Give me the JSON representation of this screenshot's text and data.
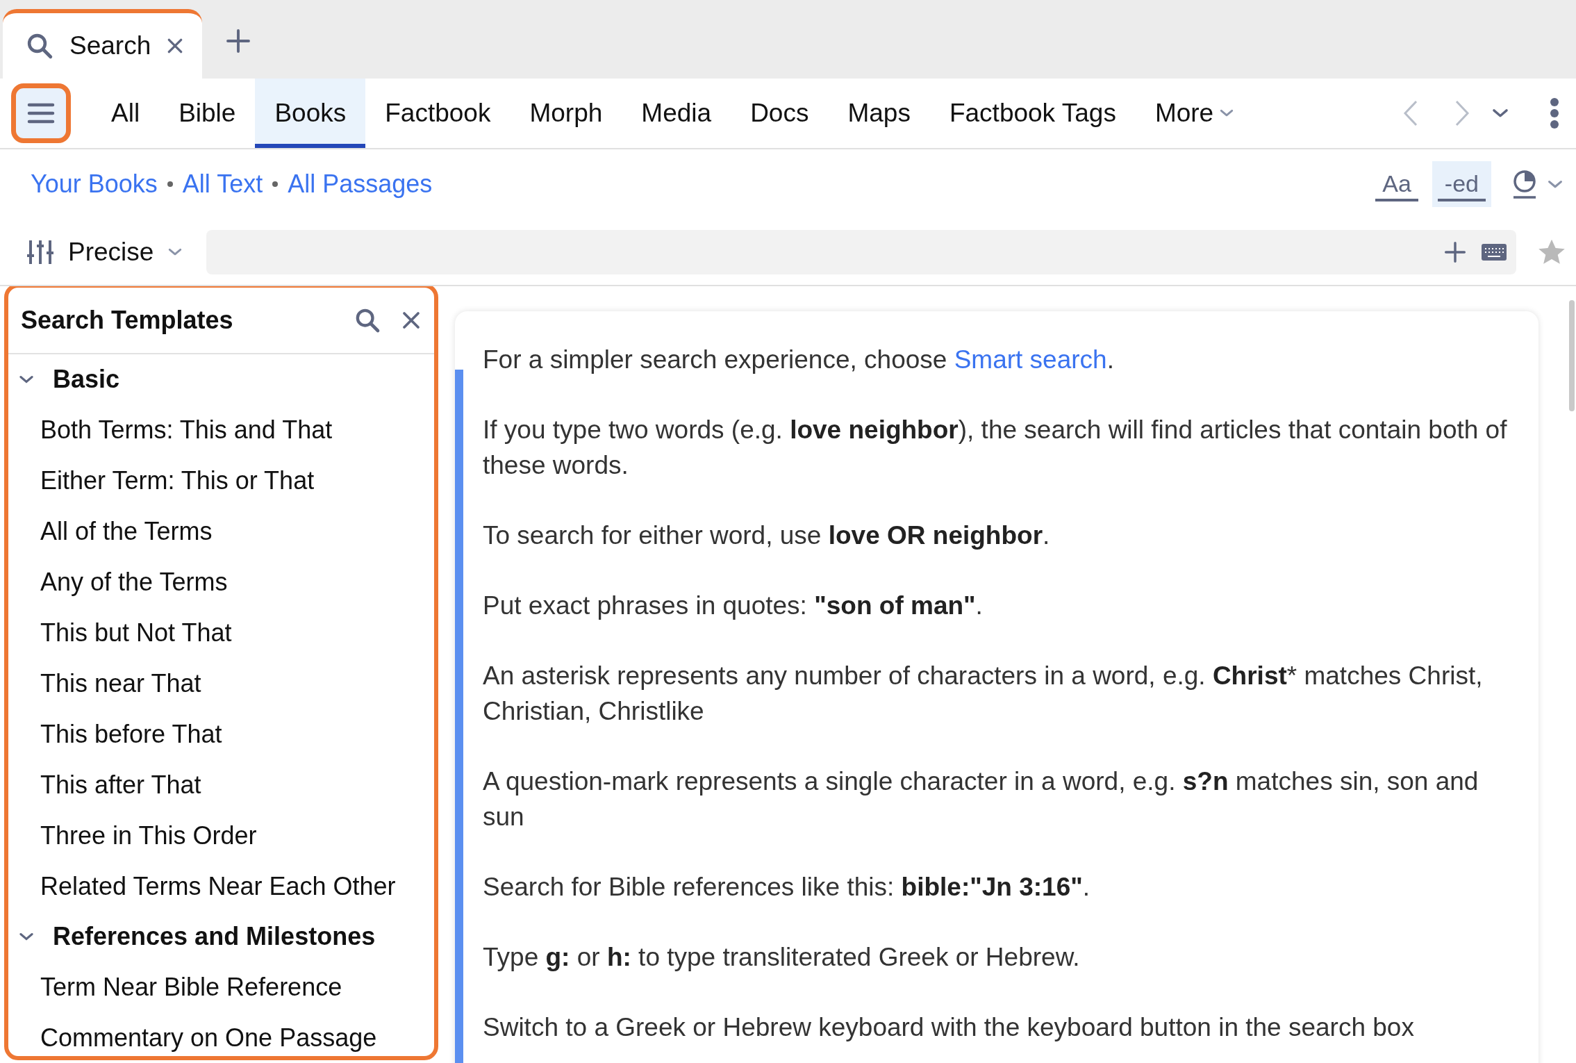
{
  "tabs": [
    {
      "label": "Search",
      "selected": true
    }
  ],
  "menu_button": {
    "highlighted": true
  },
  "nav": [
    {
      "label": "All",
      "selected": false,
      "kind": "tab"
    },
    {
      "label": "Bible",
      "selected": false,
      "kind": "tab"
    },
    {
      "label": "Books",
      "selected": true,
      "kind": "tab"
    },
    {
      "label": "Factbook",
      "selected": false,
      "kind": "tab"
    },
    {
      "label": "Morph",
      "selected": false,
      "kind": "tab"
    },
    {
      "label": "Media",
      "selected": false,
      "kind": "tab"
    },
    {
      "label": "Docs",
      "selected": false,
      "kind": "tab"
    },
    {
      "label": "Maps",
      "selected": false,
      "kind": "tab"
    },
    {
      "label": "Factbook Tags",
      "selected": false,
      "kind": "tab"
    },
    {
      "label": "More",
      "selected": false,
      "kind": "dropdown"
    }
  ],
  "scope": [
    "Your Books",
    "All Text",
    "All Passages"
  ],
  "format_buttons": [
    {
      "label": "Aa",
      "selected": false
    },
    {
      "label": "-ed",
      "selected": true
    }
  ],
  "search": {
    "mode": "Precise",
    "starred": false
  },
  "templates": {
    "title": "Search Templates",
    "highlighted": true,
    "groups": [
      {
        "label": "Basic",
        "expanded": true,
        "children": [
          {
            "label": "Both Terms: This and That"
          },
          {
            "label": "Either Term: This or That"
          },
          {
            "label": "All of the Terms"
          },
          {
            "label": "Any of the Terms"
          },
          {
            "label": "This but Not That"
          },
          {
            "label": "This near That"
          },
          {
            "label": "This before That"
          },
          {
            "label": "This after That"
          },
          {
            "label": "Three in This Order"
          },
          {
            "label": "Related Terms Near Each Other"
          }
        ]
      },
      {
        "label": "References and Milestones",
        "expanded": true,
        "children": [
          {
            "label": "Term Near Bible Reference"
          },
          {
            "label": "Commentary on One Passage"
          }
        ]
      }
    ]
  },
  "help": [
    {
      "text": "For a simpler search experience, choose ",
      "link": "Smart search",
      "after": "."
    },
    {
      "text": "If you type two words (e.g. **love neighbor**), the search will find articles that contain both of these words."
    },
    {
      "text": "To search for either word, use **love OR neighbor**."
    },
    {
      "text": "Put exact phrases in quotes: **\"son of man\"**."
    },
    {
      "text": "An asterisk represents any number of characters in a word, e.g. **Christ*** matches Christ, Christian, Christlike"
    },
    {
      "text": "A question-mark represents a single character in a word, e.g. **s?n** matches sin, son and sun"
    },
    {
      "text": "Search for Bible references like this: **bible:\"Jn 3:16\"**."
    },
    {
      "text": "Type **g:** or **h:** to type transliterated Greek or Hebrew."
    },
    {
      "text": "Switch to a Greek or Hebrew keyboard with the keyboard button in the search box"
    }
  ]
}
